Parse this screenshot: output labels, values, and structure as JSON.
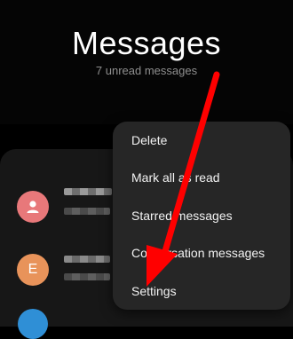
{
  "header": {
    "title": "Messages",
    "subtitle": "7 unread messages"
  },
  "conversations": [
    {
      "avatar_icon": "person-icon",
      "avatar_letter": "",
      "avatar_color": "#e8787a"
    },
    {
      "avatar_icon": "",
      "avatar_letter": "E",
      "avatar_color": "#e8935a"
    }
  ],
  "menu": {
    "items": [
      {
        "label": "Delete"
      },
      {
        "label": "Mark all as read"
      },
      {
        "label": "Starred messages"
      },
      {
        "label": "Conversation messages"
      },
      {
        "label": "Settings"
      }
    ]
  },
  "annotation": {
    "arrow_color": "#ff0000"
  }
}
